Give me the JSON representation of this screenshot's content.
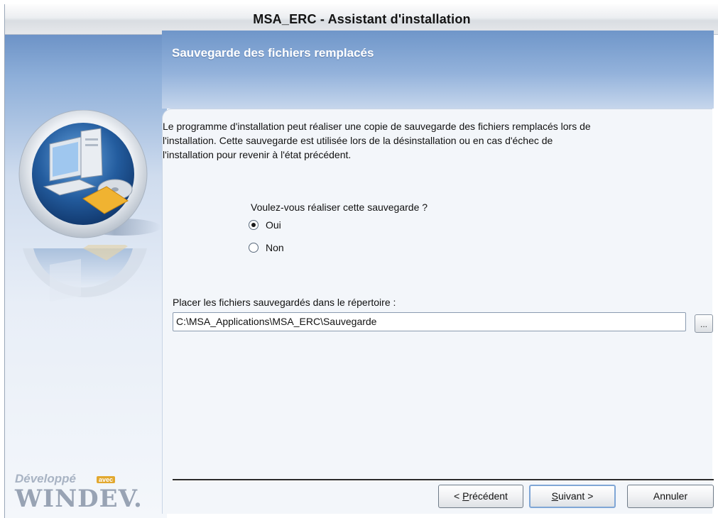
{
  "window": {
    "title": "MSA_ERC - Assistant d'installation"
  },
  "header": {
    "title": "Sauvegarde des fichiers remplacés"
  },
  "content": {
    "description_line1": "Le programme d'installation peut réaliser une copie de sauvegarde des fichiers remplacés lors de",
    "description_line2": "l'installation. Cette sauvegarde est utilisée lors de la désinstallation ou en cas d'échec de",
    "description_line3": "l'installation pour revenir à l'état précédent.",
    "question": "Voulez-vous réaliser cette sauvegarde ?",
    "options": [
      {
        "label": "Oui",
        "selected": true
      },
      {
        "label": "Non",
        "selected": false
      }
    ],
    "directory_label": "Placer les fichiers sauvegardés dans le répertoire :",
    "directory_value": "C:\\MSA_Applications\\MSA_ERC\\Sauvegarde",
    "browse_label": "..."
  },
  "buttons": {
    "previous_prefix": "< ",
    "previous_mnemonic": "P",
    "previous_rest": "récédent",
    "next_mnemonic": "S",
    "next_rest": "uivant >",
    "cancel": "Annuler"
  },
  "branding": {
    "line1": "Développé",
    "avec": "avec",
    "line2": "WINDEV."
  },
  "colors": {
    "header_blue": "#6f96c9",
    "content_bg": "#f3f6fa",
    "accent_orange": "#e2a82f"
  },
  "icons": {
    "illustration": "computer-backup-icon",
    "illustration_reflection": "computer-backup-reflection-icon"
  }
}
